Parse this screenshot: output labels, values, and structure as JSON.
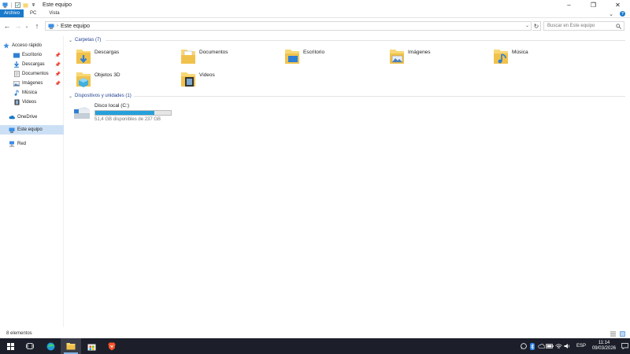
{
  "window": {
    "title": "Este equipo"
  },
  "ribbon": {
    "tabs": [
      "Archivo",
      "PC",
      "Vista"
    ]
  },
  "address": {
    "path": "Este equipo",
    "search_placeholder": "Buscar en Este equipo"
  },
  "sidebar": {
    "quick_access": "Acceso rápido",
    "items": [
      {
        "label": "Escritorio",
        "icon": "desktop-icon",
        "pinned": true
      },
      {
        "label": "Descargas",
        "icon": "download-icon",
        "pinned": true
      },
      {
        "label": "Documentos",
        "icon": "documents-icon",
        "pinned": true
      },
      {
        "label": "Imágenes",
        "icon": "pictures-icon",
        "pinned": true
      },
      {
        "label": "Música",
        "icon": "music-icon",
        "pinned": false
      },
      {
        "label": "Videos",
        "icon": "videos-icon",
        "pinned": false
      }
    ],
    "onedrive": "OneDrive",
    "this_pc": "Este equipo",
    "network": "Red"
  },
  "content": {
    "folders_header": "Carpetas (7)",
    "folders": [
      "Descargas",
      "Documentos",
      "Escritorio",
      "Imágenes",
      "Música",
      "Objetos 3D",
      "Videos"
    ],
    "devices_header": "Dispositivos y unidades (1)",
    "drive": {
      "name": "Disco local (C:)",
      "free_text": "51,4 GB disponibles de 237 GB",
      "used_fraction": 0.783
    }
  },
  "status": {
    "count": "8 elementos"
  },
  "taskbar": {
    "lang": "ESP",
    "time": "11:14",
    "date": "09/03/2026"
  },
  "colors": {
    "accent": "#1979ca",
    "folder": "#f8d775",
    "selected": "#cce0f5",
    "drive_fill": "#26a0da",
    "taskbar": "#1c1f2a"
  }
}
